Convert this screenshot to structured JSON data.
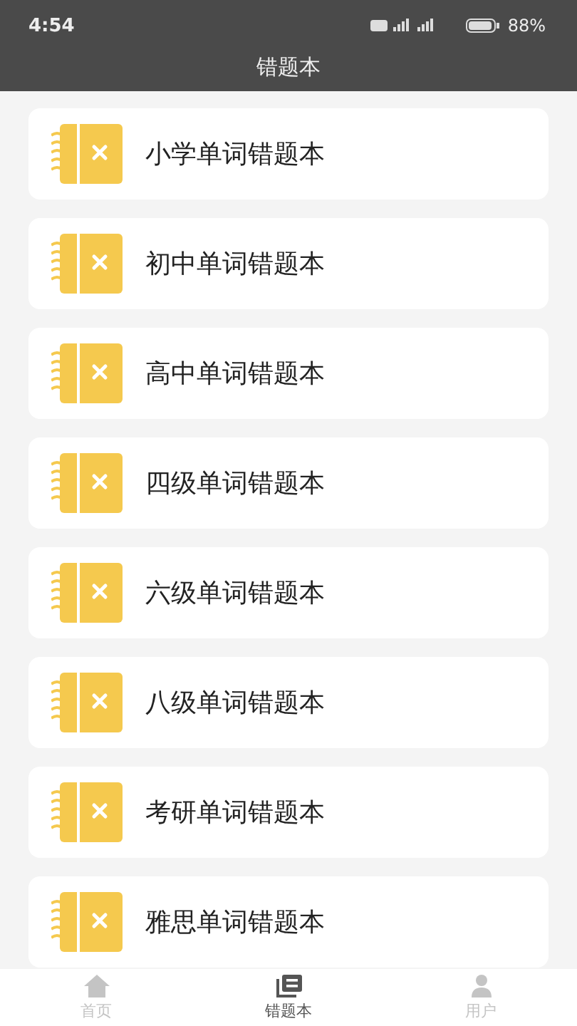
{
  "status_bar": {
    "time": "4:54",
    "battery": "88%"
  },
  "header": {
    "title": "错题本"
  },
  "notebooks": [
    {
      "label": "小学单词错题本"
    },
    {
      "label": "初中单词错题本"
    },
    {
      "label": "高中单词错题本"
    },
    {
      "label": "四级单词错题本"
    },
    {
      "label": "六级单词错题本"
    },
    {
      "label": "八级单词错题本"
    },
    {
      "label": "考研单词错题本"
    },
    {
      "label": "雅思单词错题本"
    }
  ],
  "tab_bar": [
    {
      "label": "首页",
      "kind": "home",
      "selected": false
    },
    {
      "label": "错题本",
      "kind": "book",
      "selected": true
    },
    {
      "label": "用户",
      "kind": "user",
      "selected": false
    }
  ]
}
